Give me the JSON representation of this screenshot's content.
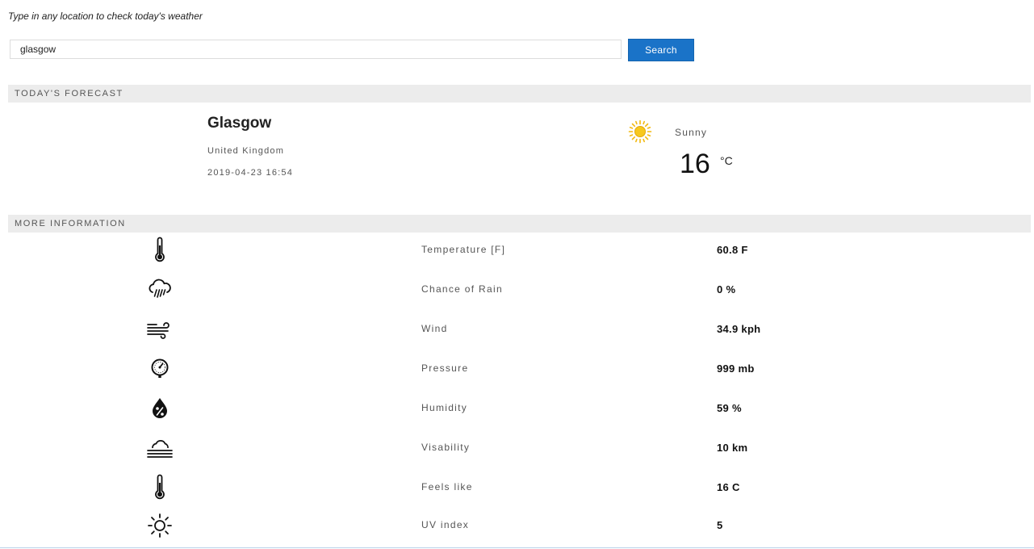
{
  "search": {
    "hint": "Type in any location to check today's weather",
    "value": "glasgow",
    "button_label": "Search"
  },
  "forecast": {
    "section_title": "TODAY'S FORECAST",
    "city": "Glasgow",
    "country": "United Kingdom",
    "datetime": "2019-04-23 16:54",
    "condition": "Sunny",
    "condition_icon": "sun-icon",
    "temperature": "16",
    "unit": "°C"
  },
  "more_info": {
    "section_title": "MORE INFORMATION",
    "rows": [
      {
        "icon": "thermometer-icon",
        "label": "Temperature [F]",
        "value": "60.8 F"
      },
      {
        "icon": "rain-cloud-icon",
        "label": "Chance of Rain",
        "value": "0 %"
      },
      {
        "icon": "wind-icon",
        "label": "Wind",
        "value": "34.9 kph"
      },
      {
        "icon": "pressure-gauge-icon",
        "label": "Pressure",
        "value": "999 mb"
      },
      {
        "icon": "humidity-icon",
        "label": "Humidity",
        "value": "59 %"
      },
      {
        "icon": "fog-icon",
        "label": "Visability",
        "value": "10 km"
      },
      {
        "icon": "thermometer-icon",
        "label": "Feels like",
        "value": "16 C"
      },
      {
        "icon": "uv-sun-icon",
        "label": "UV index",
        "value": "5"
      }
    ]
  },
  "colors": {
    "accent": "#1a73c8",
    "section_bar": "#ececec",
    "sun": "#f5c518"
  }
}
